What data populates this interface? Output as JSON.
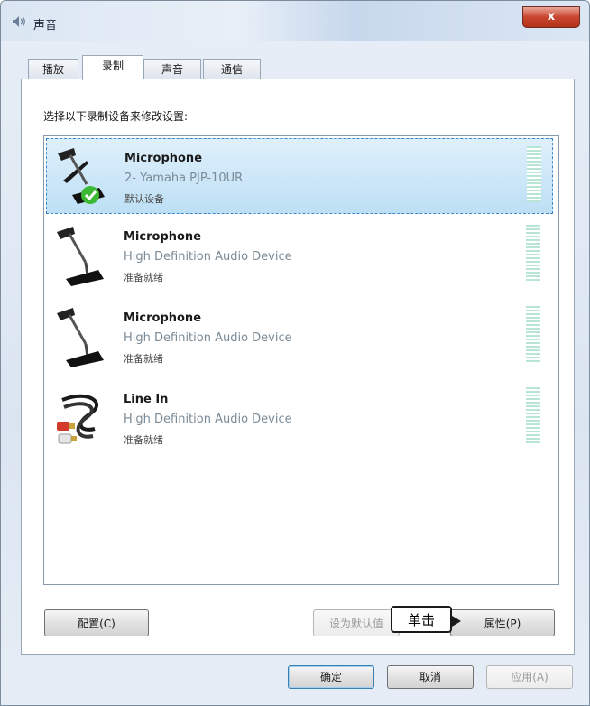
{
  "window": {
    "title": "声音",
    "close_label": "x"
  },
  "tabs": [
    {
      "label": "播放"
    },
    {
      "label": "录制"
    },
    {
      "label": "声音"
    },
    {
      "label": "通信"
    }
  ],
  "instruction": "选择以下录制设备来修改设置:",
  "devices": [
    {
      "name": "Microphone",
      "description": "2- Yamaha PJP-10UR",
      "status": "默认设备",
      "icon": "microphone-icon",
      "selected": true,
      "is_default": true
    },
    {
      "name": "Microphone",
      "description": "High Definition Audio Device",
      "status": "准备就绪",
      "icon": "microphone-icon",
      "selected": false
    },
    {
      "name": "Microphone",
      "description": "High Definition Audio Device",
      "status": "准备就绪",
      "icon": "microphone-icon",
      "selected": false
    },
    {
      "name": "Line In",
      "description": "High Definition Audio Device",
      "status": "准备就绪",
      "icon": "line-in-cable-icon",
      "selected": false
    }
  ],
  "buttons": {
    "configure": "配置(C)",
    "set_default": "设为默认值",
    "properties": "属性(P)",
    "ok": "确定",
    "cancel": "取消",
    "apply": "应用(A)"
  },
  "callout": "单击",
  "colors": {
    "selection": "#bddff5",
    "close": "#c9452f",
    "default_check": "#3cb832"
  }
}
